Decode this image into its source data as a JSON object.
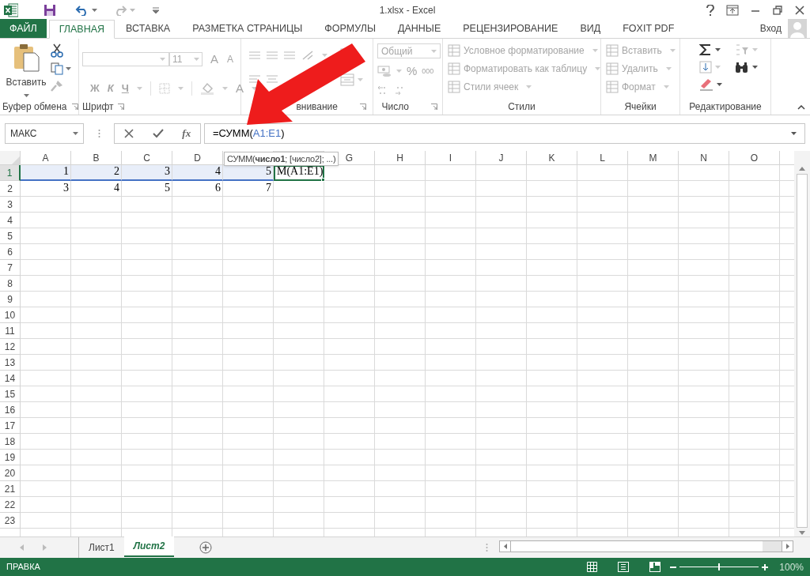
{
  "window": {
    "title": "1.xlsx - Excel"
  },
  "tabs": [
    {
      "label": "ФАЙЛ",
      "kind": "file",
      "selected": false
    },
    {
      "label": "ГЛАВНАЯ",
      "kind": "tab",
      "selected": true
    },
    {
      "label": "ВСТАВКА",
      "kind": "tab",
      "selected": false
    },
    {
      "label": "РАЗМЕТКА СТРАНИЦЫ",
      "kind": "tab",
      "selected": false
    },
    {
      "label": "ФОРМУЛЫ",
      "kind": "tab",
      "selected": false
    },
    {
      "label": "ДАННЫЕ",
      "kind": "tab",
      "selected": false
    },
    {
      "label": "РЕЦЕНЗИРОВАНИЕ",
      "kind": "tab",
      "selected": false
    },
    {
      "label": "ВИД",
      "kind": "tab",
      "selected": false
    },
    {
      "label": "FOXIT PDF",
      "kind": "tab",
      "selected": false
    }
  ],
  "account": {
    "label": "Вход"
  },
  "ribbon": {
    "groups": [
      {
        "kind": "clipboard",
        "label": "Буфер обмена",
        "paste_label": "Вставить"
      },
      {
        "kind": "font",
        "label": "Шрифт",
        "disabled": true,
        "font_size": "11",
        "grow": "A",
        "shrink": "A",
        "bold": "Ж",
        "italic": "К",
        "underline": "Ч",
        "font_color": "A"
      },
      {
        "kind": "alignment",
        "label": "внивание",
        "disabled": true
      },
      {
        "kind": "number",
        "label": "Число",
        "disabled": true,
        "format": "Общий",
        "percent": "%",
        "thousands": "000"
      },
      {
        "kind": "styles",
        "label": "Стили",
        "disabled": true,
        "items": [
          "Условное форматирование",
          "Форматировать как таблицу",
          "Стили ячеек"
        ]
      },
      {
        "kind": "cells",
        "label": "Ячейки",
        "disabled": true,
        "items": [
          "Вставить",
          "Удалить",
          "Формат"
        ]
      },
      {
        "kind": "editing",
        "label": "Редактирование"
      }
    ]
  },
  "formula_bar": {
    "name_box": "МАКС",
    "function_button": "fx",
    "formula": [
      {
        "text": "=СУММ("
      },
      {
        "text": "A1:E1",
        "color": "#4472c4"
      },
      {
        "text": ")"
      }
    ]
  },
  "tooltip": "СУММ(**число1**; [число2]; ...)",
  "columns": [
    {
      "label": "A",
      "selected": false
    },
    {
      "label": "B",
      "selected": false
    },
    {
      "label": "C",
      "selected": false
    },
    {
      "label": "D",
      "selected": false
    },
    {
      "selected": false
    },
    {
      "selected": true
    },
    {
      "label": "G",
      "selected": false
    },
    {
      "label": "H",
      "selected": false
    },
    {
      "label": "I",
      "selected": false
    },
    {
      "label": "J",
      "selected": false
    },
    {
      "label": "K",
      "selected": false
    },
    {
      "label": "L",
      "selected": false
    },
    {
      "label": "M",
      "selected": false
    },
    {
      "label": "N",
      "selected": false
    },
    {
      "label": "O",
      "selected": false
    }
  ],
  "rows": [
    {
      "label": "1",
      "selected": true,
      "cells": [
        {
          "text": "1",
          "in_range": true,
          "active": false
        },
        {
          "text": "2",
          "in_range": true,
          "active": false
        },
        {
          "text": "3",
          "in_range": true,
          "active": false
        },
        {
          "text": "4",
          "in_range": true,
          "active": false
        },
        {
          "text": "5",
          "in_range": true,
          "active": false
        },
        {
          "text": "М(A1:E1)",
          "in_range": false,
          "active": true
        }
      ]
    },
    {
      "label": "2",
      "selected": false,
      "cells": [
        {
          "text": "3",
          "in_range": false,
          "active": false
        },
        {
          "text": "4",
          "in_range": false,
          "active": false
        },
        {
          "text": "5",
          "in_range": false,
          "active": false
        },
        {
          "text": "6",
          "in_range": false,
          "active": false
        },
        {
          "text": "7",
          "in_range": false,
          "active": false
        }
      ]
    },
    {
      "label": "3",
      "selected": false
    },
    {
      "label": "4",
      "selected": false
    },
    {
      "label": "5",
      "selected": false
    },
    {
      "label": "6",
      "selected": false
    },
    {
      "label": "7",
      "selected": false
    },
    {
      "label": "8",
      "selected": false
    },
    {
      "label": "9",
      "selected": false
    },
    {
      "label": "10",
      "selected": false
    },
    {
      "label": "11",
      "selected": false
    },
    {
      "label": "12",
      "selected": false
    },
    {
      "label": "13",
      "selected": false
    },
    {
      "label": "14",
      "selected": false
    },
    {
      "label": "15",
      "selected": false
    },
    {
      "label": "16",
      "selected": false
    },
    {
      "label": "17",
      "selected": false
    },
    {
      "label": "18",
      "selected": false
    },
    {
      "label": "19",
      "selected": false
    },
    {
      "label": "20",
      "selected": false
    },
    {
      "label": "21",
      "selected": false
    },
    {
      "label": "22",
      "selected": false
    },
    {
      "label": "23",
      "selected": false
    }
  ],
  "sheets": [
    {
      "label": "Лист1",
      "selected": false
    },
    {
      "label": "Лист2",
      "selected": true
    }
  ],
  "status_bar": {
    "mode": "ПРАВКА",
    "zoom": "100%",
    "level": 0.5
  }
}
